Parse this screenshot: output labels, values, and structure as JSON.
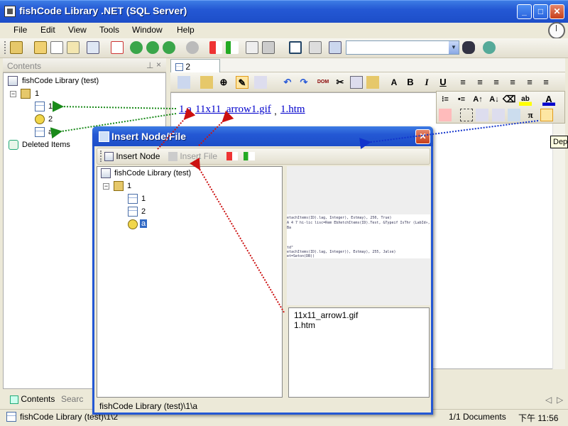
{
  "app": {
    "title": "fishCode Library .NET (SQL Server)",
    "window_buttons": {
      "minimize": "_",
      "maximize": "□",
      "close": "✕"
    }
  },
  "menu": [
    "File",
    "Edit",
    "View",
    "Tools",
    "Window",
    "Help"
  ],
  "contents_panel": {
    "title": "Contents",
    "pin": "⊥",
    "close": "×"
  },
  "tree": {
    "root": "fishCode Library (test)",
    "folder": "1",
    "children": [
      "1",
      "2",
      "a"
    ],
    "deleted": "Deleted Items"
  },
  "doc_tab": "2",
  "editor": {
    "link1": "1.a",
    "link2": "11x11_arrow1.gif",
    "sep": ",",
    "link3": "1.htm",
    "link1_comma": ""
  },
  "tooltip": "Depe",
  "left_tabs": {
    "contents": "Contents",
    "search": "Searc"
  },
  "status": {
    "path": "fishCode Library (test)\\1\\2",
    "docs": "1/1 Documents",
    "time": "下午 11:56"
  },
  "dialog": {
    "title": "Insert Node/File",
    "insert_node": "Insert Node",
    "insert_file": "Insert File",
    "tree": {
      "root": "fishCode Library (test)",
      "folder": "1",
      "children": [
        "1",
        "2",
        "a"
      ]
    },
    "files": [
      "11x11_arrow1.gif",
      "1.htm"
    ],
    "status": "fishCode Library (test)\\1\\a",
    "code_lines": [
      "etachItems(ID).lag, Integer), Estmay), 250, True)",
      "A 4 7 hi-lic lisc=Rem EbXetchItems(ID).Test, &Typeif IsThr (LabId», Ba",
      "td\"",
      "etachItems(ID).lag, Integer)), Estmay), 255, Jalse)",
      "et=Seton(DB))"
    ]
  },
  "colors": {
    "arrow_green": "#1a8a1a",
    "arrow_red": "#cc1111",
    "arrow_blue": "#1133cc",
    "title_blue": "#2458d4"
  }
}
